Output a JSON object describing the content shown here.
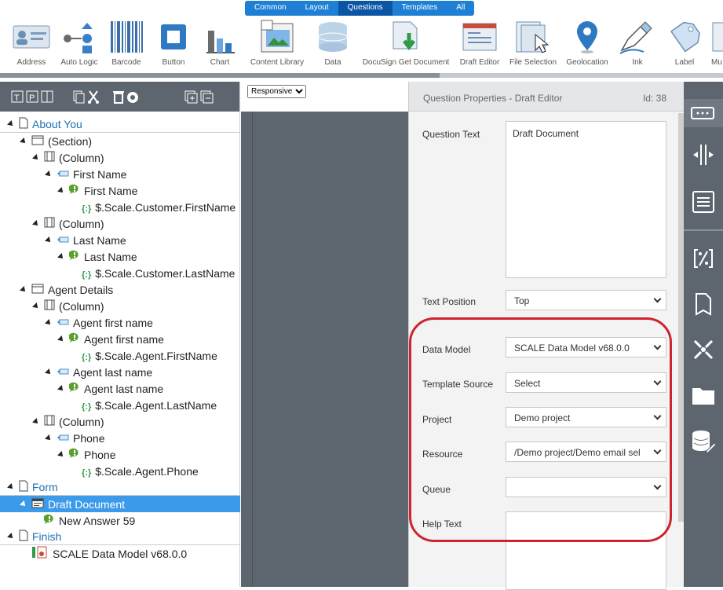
{
  "categories": [
    "Common",
    "Layout",
    "Questions",
    "Templates",
    "All"
  ],
  "tools": [
    {
      "label": "Address",
      "icon": "address-icon"
    },
    {
      "label": "Auto Logic",
      "icon": "auto-logic-icon"
    },
    {
      "label": "Barcode",
      "icon": "barcode-icon"
    },
    {
      "label": "Button",
      "icon": "button-icon"
    },
    {
      "label": "Chart",
      "icon": "chart-icon"
    },
    {
      "label": "Content Library",
      "icon": "content-library-icon"
    },
    {
      "label": "Data",
      "icon": "data-icon"
    },
    {
      "label": "DocuSign Get Document",
      "icon": "docusign-icon"
    },
    {
      "label": "Draft Editor",
      "icon": "draft-editor-icon"
    },
    {
      "label": "File Selection",
      "icon": "file-selection-icon"
    },
    {
      "label": "Geolocation",
      "icon": "geolocation-icon"
    },
    {
      "label": "Ink",
      "icon": "ink-icon"
    },
    {
      "label": "Label",
      "icon": "label-icon"
    },
    {
      "label": "Mu",
      "icon": "multi-icon"
    }
  ],
  "tree": [
    {
      "label": "About You",
      "type": "page"
    },
    {
      "label": "(Section)",
      "type": "section"
    },
    {
      "label": "(Column)",
      "type": "column"
    },
    {
      "label": "First Name",
      "type": "label"
    },
    {
      "label": "First Name",
      "type": "answer"
    },
    {
      "label": "$.Scale.Customer.FirstName",
      "type": "bind"
    },
    {
      "label": "(Column)",
      "type": "column"
    },
    {
      "label": "Last Name",
      "type": "label"
    },
    {
      "label": "Last Name",
      "type": "answer"
    },
    {
      "label": "$.Scale.Customer.LastName",
      "type": "bind"
    },
    {
      "label": "Agent Details",
      "type": "section"
    },
    {
      "label": "(Column)",
      "type": "column"
    },
    {
      "label": "Agent first name",
      "type": "label"
    },
    {
      "label": "Agent first name",
      "type": "answer"
    },
    {
      "label": "$.Scale.Agent.FirstName",
      "type": "bind"
    },
    {
      "label": "Agent last name",
      "type": "label"
    },
    {
      "label": "Agent last name",
      "type": "answer"
    },
    {
      "label": "$.Scale.Agent.LastName",
      "type": "bind"
    },
    {
      "label": "(Column)",
      "type": "column"
    },
    {
      "label": "Phone",
      "type": "label"
    },
    {
      "label": "Phone",
      "type": "answer"
    },
    {
      "label": "$.Scale.Agent.Phone",
      "type": "bind"
    },
    {
      "label": "Form",
      "type": "page"
    },
    {
      "label": "Draft Document",
      "type": "draft",
      "selected": true
    },
    {
      "label": "New Answer 59",
      "type": "answer"
    },
    {
      "label": "Finish",
      "type": "page"
    },
    {
      "label": "SCALE Data Model v68.0.0",
      "type": "model"
    }
  ],
  "canvas": {
    "view_select": "Responsive"
  },
  "props": {
    "title": "Question Properties - Draft Editor",
    "id": "Id: 38",
    "question_text_label": "Question Text",
    "question_text": "Draft Document",
    "text_position_label": "Text Position",
    "text_position": "Top",
    "data_model_label": "Data Model",
    "data_model": "SCALE Data Model v68.0.0",
    "template_source_label": "Template Source",
    "template_source": "Select",
    "project_label": "Project",
    "project": "Demo project",
    "resource_label": "Resource",
    "resource": "/Demo project/Demo email sel",
    "queue_label": "Queue",
    "queue": "",
    "help_text_label": "Help Text",
    "help_text": ""
  },
  "colors": {
    "highlight": "#d0232d",
    "selected": "#3b9bea",
    "accent": "#1e7fd4"
  }
}
